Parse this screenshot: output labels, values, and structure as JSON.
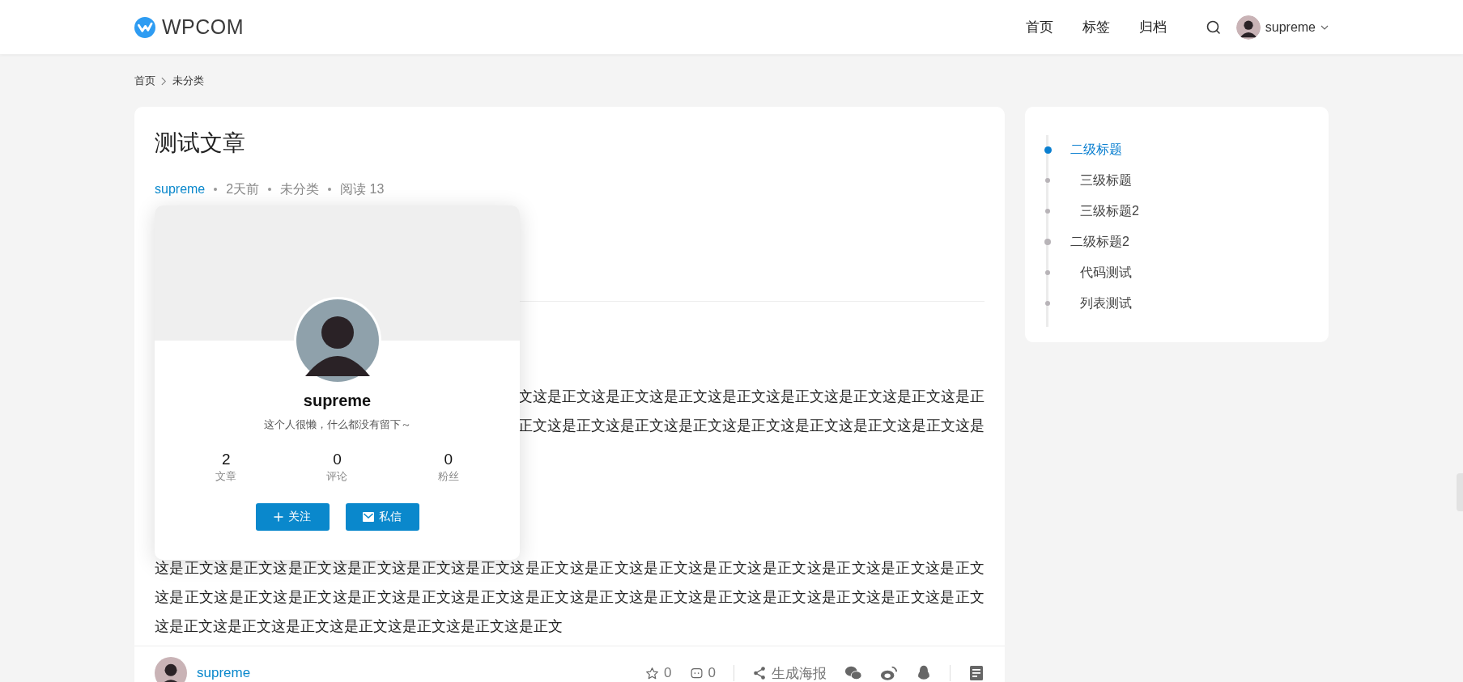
{
  "header": {
    "logo": "WPCOM",
    "nav": [
      {
        "label": "首页"
      },
      {
        "label": "标签"
      },
      {
        "label": "归档"
      }
    ],
    "user": "supreme"
  },
  "breadcrumb": [
    "首页",
    "未分类"
  ],
  "article": {
    "title": "测试文章",
    "meta": {
      "author": "supreme",
      "time": "2天前",
      "category": "未分类",
      "views": "阅读 13"
    },
    "paragraphs": [
      {
        "kind": "partial",
        "lines": [
          "文这是正文这是正文这是正文这是正文这是正文这是正文这是正文这是正",
          "正文这是正文这是正文这是正文这是正文这是正文这是正文这是正文这是"
        ]
      },
      {
        "kind": "full",
        "text": "这是正文这是正文这是正文这是正文这是正文这是正文这是正文这是正文这是正文这是正文这是正文这是正文这是正文这是正文这是正文这是正文这是正文这是正文这是正文这是正文这是正文这是正文这是正文这是正文这是正文这是正文这是正文这是正文这是正文这是正文这是正文这是正文这是正文这是正文这是正文"
      }
    ],
    "footer": {
      "author": "supreme",
      "likes": "0",
      "comments": "0",
      "poster": "生成海报"
    }
  },
  "author_card": {
    "name": "supreme",
    "bio": "这个人很懒，什么都没有留下～",
    "stats": [
      {
        "value": "2",
        "label": "文章"
      },
      {
        "value": "0",
        "label": "评论"
      },
      {
        "value": "0",
        "label": "粉丝"
      }
    ],
    "buttons": [
      {
        "kind": "follow",
        "label": "关注"
      },
      {
        "kind": "message",
        "label": "私信"
      }
    ]
  },
  "toc": [
    {
      "label": "二级标题",
      "selected": true,
      "children": [
        {
          "label": "三级标题",
          "selected": false
        },
        {
          "label": "三级标题2",
          "selected": false
        }
      ]
    },
    {
      "label": "二级标题2",
      "selected": false,
      "children": [
        {
          "label": "代码测试",
          "selected": false
        },
        {
          "label": "列表测试",
          "selected": false
        }
      ]
    }
  ]
}
